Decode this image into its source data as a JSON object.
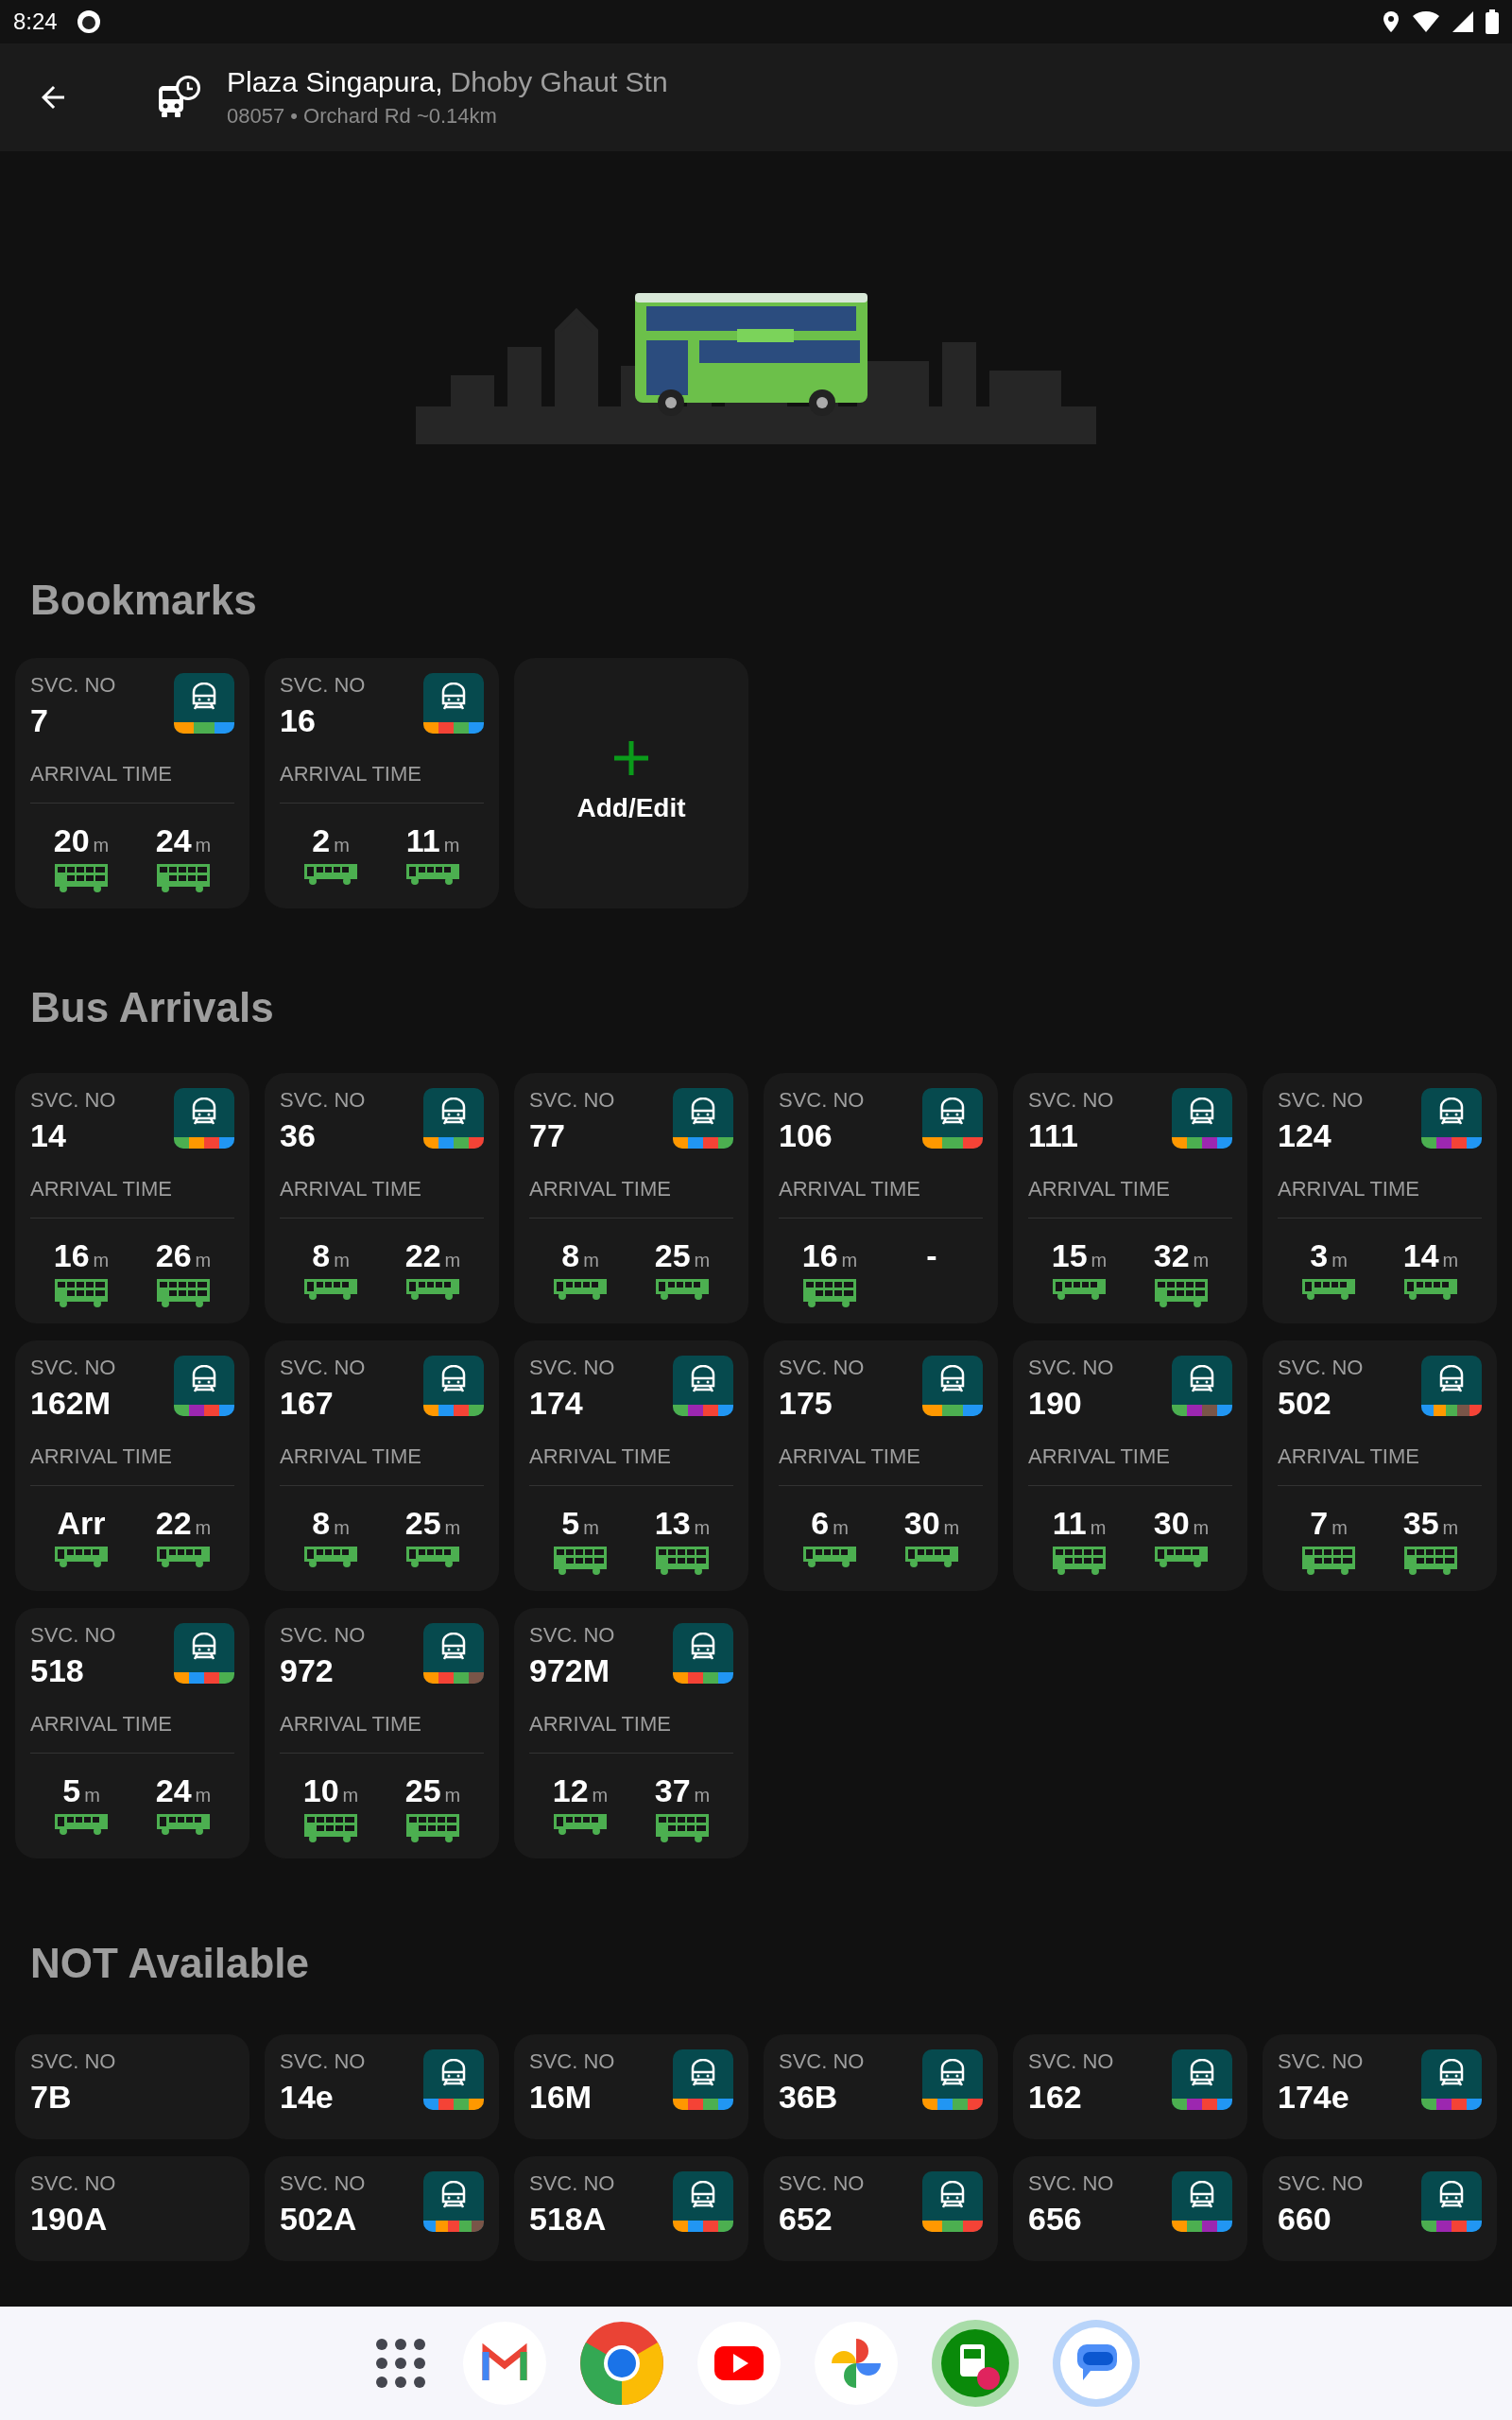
{
  "status_bar": {
    "time": "8:24"
  },
  "header": {
    "stop_name": "Plaza Singapura",
    "separator": ",",
    "landmark": "Dhoby Ghaut Stn",
    "details": "08057 • Orchard Rd ~0.14km"
  },
  "bookmarks": {
    "title": "Bookmarks",
    "add_button": "Add/Edit",
    "services": [
      {
        "svc_label": "SVC. NO",
        "number": "7",
        "arrival_label": "ARRIVAL TIME",
        "lines": [
          {
            "color": "#ff9800"
          },
          {
            "color": "#4caf50"
          },
          {
            "color": "#2196f3"
          }
        ],
        "arrivals": [
          {
            "value": "20",
            "unit": "m",
            "kind": "double"
          },
          {
            "value": "24",
            "unit": "m",
            "kind": "double"
          }
        ]
      },
      {
        "svc_label": "SVC. NO",
        "number": "16",
        "arrival_label": "ARRIVAL TIME",
        "lines": [
          {
            "color": "#ff9800"
          },
          {
            "color": "#f44336"
          },
          {
            "color": "#4caf50"
          },
          {
            "color": "#2196f3"
          }
        ],
        "arrivals": [
          {
            "value": "2",
            "unit": "m",
            "kind": "single"
          },
          {
            "value": "11",
            "unit": "m",
            "kind": "single"
          }
        ]
      }
    ]
  },
  "bus_arrivals": {
    "title": "Bus Arrivals",
    "services": [
      {
        "svc_label": "SVC. NO",
        "number": "14",
        "arrival_label": "ARRIVAL TIME",
        "lines": [
          {
            "color": "#4caf50"
          },
          {
            "color": "#ff9800"
          },
          {
            "color": "#f44336"
          },
          {
            "color": "#2196f3"
          }
        ],
        "arrivals": [
          {
            "value": "16",
            "unit": "m",
            "kind": "double"
          },
          {
            "value": "26",
            "unit": "m",
            "kind": "double"
          }
        ]
      },
      {
        "svc_label": "SVC. NO",
        "number": "36",
        "arrival_label": "ARRIVAL TIME",
        "lines": [
          {
            "color": "#ff9800"
          },
          {
            "color": "#2196f3"
          },
          {
            "color": "#4caf50"
          },
          {
            "color": "#f44336"
          }
        ],
        "arrivals": [
          {
            "value": "8",
            "unit": "m",
            "kind": "single"
          },
          {
            "value": "22",
            "unit": "m",
            "kind": "single"
          }
        ]
      },
      {
        "svc_label": "SVC. NO",
        "number": "77",
        "arrival_label": "ARRIVAL TIME",
        "lines": [
          {
            "color": "#ff9800"
          },
          {
            "color": "#2196f3"
          },
          {
            "color": "#f44336"
          },
          {
            "color": "#4caf50"
          }
        ],
        "arrivals": [
          {
            "value": "8",
            "unit": "m",
            "kind": "single"
          },
          {
            "value": "25",
            "unit": "m",
            "kind": "single"
          }
        ]
      },
      {
        "svc_label": "SVC. NO",
        "number": "106",
        "arrival_label": "ARRIVAL TIME",
        "lines": [
          {
            "color": "#ff9800"
          },
          {
            "color": "#4caf50"
          },
          {
            "color": "#f44336"
          }
        ],
        "arrivals": [
          {
            "value": "16",
            "unit": "m",
            "kind": "double"
          },
          {
            "value": "-",
            "kind": "none"
          }
        ]
      },
      {
        "svc_label": "SVC. NO",
        "number": "111",
        "arrival_label": "ARRIVAL TIME",
        "lines": [
          {
            "color": "#ff9800"
          },
          {
            "color": "#4caf50"
          },
          {
            "color": "#9c27b0"
          },
          {
            "color": "#2196f3"
          }
        ],
        "arrivals": [
          {
            "value": "15",
            "unit": "m",
            "kind": "single"
          },
          {
            "value": "32",
            "unit": "m",
            "kind": "double"
          }
        ]
      },
      {
        "svc_label": "SVC. NO",
        "number": "124",
        "arrival_label": "ARRIVAL TIME",
        "lines": [
          {
            "color": "#4caf50"
          },
          {
            "color": "#9c27b0"
          },
          {
            "color": "#f44336"
          },
          {
            "color": "#2196f3"
          }
        ],
        "arrivals": [
          {
            "value": "3",
            "unit": "m",
            "kind": "single"
          },
          {
            "value": "14",
            "unit": "m",
            "kind": "single"
          }
        ]
      },
      {
        "svc_label": "SVC. NO",
        "number": "162M",
        "arrival_label": "ARRIVAL TIME",
        "lines": [
          {
            "color": "#4caf50"
          },
          {
            "color": "#9c27b0"
          },
          {
            "color": "#f44336"
          },
          {
            "color": "#2196f3"
          }
        ],
        "arrivals": [
          {
            "value": "Arr",
            "kind": "single"
          },
          {
            "value": "22",
            "unit": "m",
            "kind": "single"
          }
        ]
      },
      {
        "svc_label": "SVC. NO",
        "number": "167",
        "arrival_label": "ARRIVAL TIME",
        "lines": [
          {
            "color": "#ff9800"
          },
          {
            "color": "#2196f3"
          },
          {
            "color": "#f44336"
          },
          {
            "color": "#4caf50"
          }
        ],
        "arrivals": [
          {
            "value": "8",
            "unit": "m",
            "kind": "single"
          },
          {
            "value": "25",
            "unit": "m",
            "kind": "single"
          }
        ]
      },
      {
        "svc_label": "SVC. NO",
        "number": "174",
        "arrival_label": "ARRIVAL TIME",
        "lines": [
          {
            "color": "#4caf50"
          },
          {
            "color": "#9c27b0"
          },
          {
            "color": "#f44336"
          },
          {
            "color": "#2196f3"
          }
        ],
        "arrivals": [
          {
            "value": "5",
            "unit": "m",
            "kind": "double"
          },
          {
            "value": "13",
            "unit": "m",
            "kind": "double"
          }
        ]
      },
      {
        "svc_label": "SVC. NO",
        "number": "175",
        "arrival_label": "ARRIVAL TIME",
        "lines": [
          {
            "color": "#ff9800"
          },
          {
            "color": "#4caf50"
          },
          {
            "color": "#2196f3"
          }
        ],
        "arrivals": [
          {
            "value": "6",
            "unit": "m",
            "kind": "single"
          },
          {
            "value": "30",
            "unit": "m",
            "kind": "single"
          }
        ]
      },
      {
        "svc_label": "SVC. NO",
        "number": "190",
        "arrival_label": "ARRIVAL TIME",
        "lines": [
          {
            "color": "#4caf50"
          },
          {
            "color": "#9c27b0"
          },
          {
            "color": "#795548"
          },
          {
            "color": "#2196f3"
          }
        ],
        "arrivals": [
          {
            "value": "11",
            "unit": "m",
            "kind": "double"
          },
          {
            "value": "30",
            "unit": "m",
            "kind": "single"
          }
        ]
      },
      {
        "svc_label": "SVC. NO",
        "number": "502",
        "arrival_label": "ARRIVAL TIME",
        "lines": [
          {
            "color": "#2196f3"
          },
          {
            "color": "#ff9800"
          },
          {
            "color": "#4caf50"
          },
          {
            "color": "#795548"
          },
          {
            "color": "#f44336"
          }
        ],
        "arrivals": [
          {
            "value": "7",
            "unit": "m",
            "kind": "double"
          },
          {
            "value": "35",
            "unit": "m",
            "kind": "double"
          }
        ]
      },
      {
        "svc_label": "SVC. NO",
        "number": "518",
        "arrival_label": "ARRIVAL TIME",
        "lines": [
          {
            "color": "#ff9800"
          },
          {
            "color": "#2196f3"
          },
          {
            "color": "#f44336"
          },
          {
            "color": "#4caf50"
          }
        ],
        "arrivals": [
          {
            "value": "5",
            "unit": "m",
            "kind": "single"
          },
          {
            "value": "24",
            "unit": "m",
            "kind": "single"
          }
        ]
      },
      {
        "svc_label": "SVC. NO",
        "number": "972",
        "arrival_label": "ARRIVAL TIME",
        "lines": [
          {
            "color": "#ff9800"
          },
          {
            "color": "#f44336"
          },
          {
            "color": "#4caf50"
          },
          {
            "color": "#795548"
          }
        ],
        "arrivals": [
          {
            "value": "10",
            "unit": "m",
            "kind": "double"
          },
          {
            "value": "25",
            "unit": "m",
            "kind": "double"
          }
        ]
      },
      {
        "svc_label": "SVC. NO",
        "number": "972M",
        "arrival_label": "ARRIVAL TIME",
        "lines": [
          {
            "color": "#ff9800"
          },
          {
            "color": "#f44336"
          },
          {
            "color": "#4caf50"
          },
          {
            "color": "#2196f3"
          }
        ],
        "arrivals": [
          {
            "value": "12",
            "unit": "m",
            "kind": "single"
          },
          {
            "value": "37",
            "unit": "m",
            "kind": "double"
          }
        ]
      }
    ]
  },
  "not_available": {
    "title": "NOT Available",
    "services": [
      {
        "svc_label": "SVC. NO",
        "number": "7B"
      },
      {
        "svc_label": "SVC. NO",
        "number": "14e",
        "lines": [
          {
            "color": "#2196f3"
          },
          {
            "color": "#f44336"
          },
          {
            "color": "#4caf50"
          },
          {
            "color": "#ff9800"
          }
        ]
      },
      {
        "svc_label": "SVC. NO",
        "number": "16M",
        "lines": [
          {
            "color": "#ff9800"
          },
          {
            "color": "#f44336"
          },
          {
            "color": "#4caf50"
          },
          {
            "color": "#2196f3"
          }
        ]
      },
      {
        "svc_label": "SVC. NO",
        "number": "36B",
        "lines": [
          {
            "color": "#ff9800"
          },
          {
            "color": "#2196f3"
          },
          {
            "color": "#4caf50"
          },
          {
            "color": "#f44336"
          }
        ]
      },
      {
        "svc_label": "SVC. NO",
        "number": "162",
        "lines": [
          {
            "color": "#4caf50"
          },
          {
            "color": "#9c27b0"
          },
          {
            "color": "#f44336"
          },
          {
            "color": "#2196f3"
          }
        ]
      },
      {
        "svc_label": "SVC. NO",
        "number": "174e",
        "lines": [
          {
            "color": "#4caf50"
          },
          {
            "color": "#9c27b0"
          },
          {
            "color": "#f44336"
          },
          {
            "color": "#2196f3"
          }
        ]
      },
      {
        "svc_label": "SVC. NO",
        "number": "190A"
      },
      {
        "svc_label": "SVC. NO",
        "number": "502A",
        "lines": [
          {
            "color": "#2196f3"
          },
          {
            "color": "#ff9800"
          },
          {
            "color": "#f44336"
          },
          {
            "color": "#4caf50"
          },
          {
            "color": "#795548"
          }
        ]
      },
      {
        "svc_label": "SVC. NO",
        "number": "518A",
        "lines": [
          {
            "color": "#ff9800"
          },
          {
            "color": "#2196f3"
          },
          {
            "color": "#f44336"
          },
          {
            "color": "#4caf50"
          }
        ]
      },
      {
        "svc_label": "SVC. NO",
        "number": "652",
        "lines": [
          {
            "color": "#ff9800"
          },
          {
            "color": "#4caf50"
          },
          {
            "color": "#f44336"
          }
        ]
      },
      {
        "svc_label": "SVC. NO",
        "number": "656",
        "lines": [
          {
            "color": "#ff9800"
          },
          {
            "color": "#4caf50"
          },
          {
            "color": "#9c27b0"
          },
          {
            "color": "#2196f3"
          }
        ]
      },
      {
        "svc_label": "SVC. NO",
        "number": "660",
        "lines": [
          {
            "color": "#4caf50"
          },
          {
            "color": "#9c27b0"
          },
          {
            "color": "#f44336"
          },
          {
            "color": "#2196f3"
          }
        ]
      }
    ]
  },
  "dock": {
    "apps": [
      {
        "kind": "launcher"
      },
      {
        "kind": "mail"
      },
      {
        "kind": "browser"
      },
      {
        "kind": "video"
      },
      {
        "kind": "photos"
      },
      {
        "kind": "bus"
      },
      {
        "kind": "messages"
      }
    ]
  }
}
